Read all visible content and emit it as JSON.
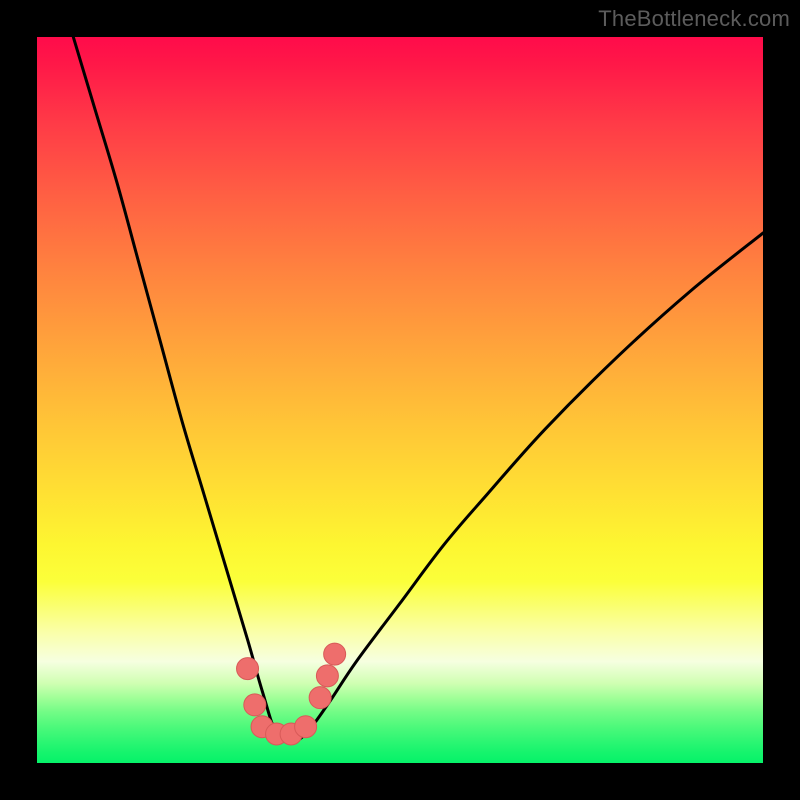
{
  "watermark": "TheBottleneck.com",
  "colors": {
    "frame": "#000000",
    "curve": "#000000",
    "marker_fill": "#ee6e6c",
    "marker_stroke": "#d85a58",
    "gradient_stops": [
      "#ff0b4a",
      "#ff1948",
      "#ff3b47",
      "#ff6043",
      "#ff823f",
      "#ffa53b",
      "#ffc437",
      "#ffe133",
      "#fdf631",
      "#fbff3a",
      "#faffa9",
      "#f6ffe0",
      "#d0ffb3",
      "#a1ff98",
      "#72fc86",
      "#4df97b",
      "#2df673",
      "#16f46d",
      "#06f269"
    ]
  },
  "chart_data": {
    "type": "line",
    "title": "",
    "xlabel": "",
    "ylabel": "",
    "xlim": [
      0,
      100
    ],
    "ylim": [
      0,
      100
    ],
    "grid": false,
    "legend": false,
    "series": [
      {
        "name": "bottleneck-curve",
        "note": "Smooth V-shaped curve; minimum near x≈33. Values estimated from pixel positions.",
        "x": [
          5,
          8,
          11,
          14,
          17,
          20,
          23,
          26,
          29,
          31,
          33,
          35,
          37,
          40,
          44,
          50,
          56,
          62,
          70,
          80,
          90,
          100
        ],
        "y": [
          100,
          90,
          80,
          69,
          58,
          47,
          37,
          27,
          17,
          10,
          4,
          3,
          4,
          8,
          14,
          22,
          30,
          37,
          46,
          56,
          65,
          73
        ]
      }
    ],
    "markers": {
      "name": "highlighted-points",
      "note": "Salmon dots clustered around the trough of the curve.",
      "points": [
        {
          "x": 29,
          "y": 13
        },
        {
          "x": 30,
          "y": 8
        },
        {
          "x": 31,
          "y": 5
        },
        {
          "x": 33,
          "y": 4
        },
        {
          "x": 35,
          "y": 4
        },
        {
          "x": 37,
          "y": 5
        },
        {
          "x": 39,
          "y": 9
        },
        {
          "x": 40,
          "y": 12
        },
        {
          "x": 41,
          "y": 15
        }
      ]
    },
    "background": {
      "type": "vertical-gradient",
      "meaning": "heat scale: red (high bottleneck) at top to green (low bottleneck) at bottom"
    }
  }
}
